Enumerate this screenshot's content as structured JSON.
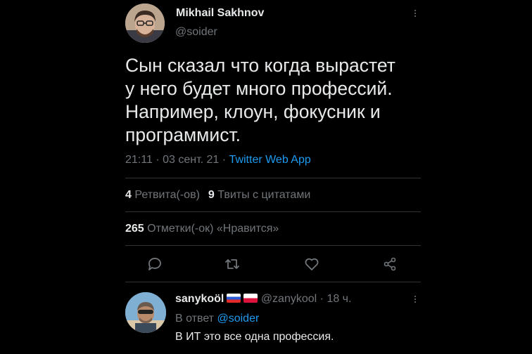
{
  "tweet": {
    "author": {
      "name": "Mikhail Sakhnov",
      "handle": "@soider"
    },
    "text_lines": [
      "Сын сказал что когда вырастет",
      "у него будет много профессий.",
      "Например, клоун, фокусник и",
      "программист."
    ],
    "time": "21:11",
    "date": "03 сент. 21",
    "separator": "·",
    "source": "Twitter Web App",
    "stats": {
      "retweets_count": "4",
      "retweets_label": "Ретвита(-ов)",
      "quotes_count": "9",
      "quotes_label": "Твиты с цитатами",
      "likes_count": "265",
      "likes_label": "Отметки(-ок) «Нравится»"
    },
    "actions": [
      "reply-icon",
      "retweet-icon",
      "like-icon",
      "share-icon"
    ]
  },
  "reply": {
    "name": "sanykoöl",
    "flags": [
      "flag-ru",
      "flag-pl"
    ],
    "handle": "@zanykool",
    "separator": "·",
    "time": "18 ч.",
    "reply_to_label": "В ответ",
    "reply_to_handle": "@soider",
    "text": "В ИТ это все одна профессия."
  },
  "colors": {
    "background": "#000000",
    "text": "#e7e9ea",
    "secondary": "#71767b",
    "accent": "#1d9bf0",
    "divider": "#2f3336"
  }
}
